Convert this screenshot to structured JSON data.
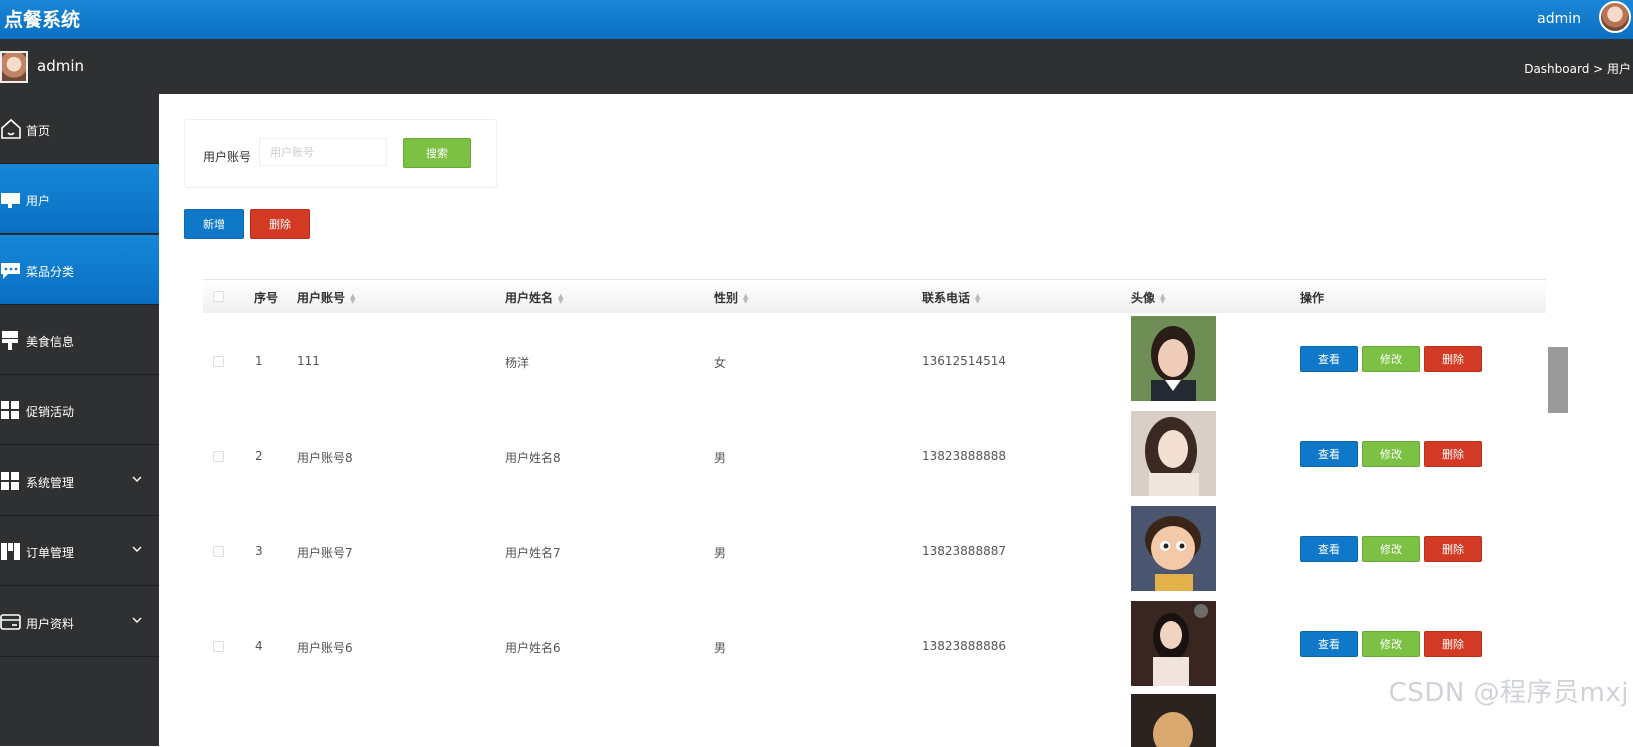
{
  "header": {
    "app_title": "点餐系统",
    "user": "admin"
  },
  "subbar": {
    "name": "admin",
    "breadcrumb": "Dashboard > 用户"
  },
  "sidebar": {
    "items": [
      {
        "label": "首页",
        "icon": "home-icon",
        "expandable": false
      },
      {
        "label": "用户",
        "icon": "monitor-icon",
        "expandable": false,
        "active": true
      },
      {
        "label": "菜品分类",
        "icon": "chat-icon",
        "expandable": false,
        "active": true
      },
      {
        "label": "美食信息",
        "icon": "stamp-icon",
        "expandable": false
      },
      {
        "label": "促销活动",
        "icon": "grid-icon",
        "expandable": false
      },
      {
        "label": "系统管理",
        "icon": "grid-icon",
        "expandable": true
      },
      {
        "label": "订单管理",
        "icon": "box-icon",
        "expandable": true
      },
      {
        "label": "用户资料",
        "icon": "card-icon",
        "expandable": true
      }
    ]
  },
  "search": {
    "label": "用户账号",
    "placeholder": "用户账号",
    "button": "搜索"
  },
  "actions": {
    "add": "新增",
    "delete": "删除"
  },
  "table": {
    "headers": [
      "序号",
      "用户账号",
      "用户姓名",
      "性别",
      "联系电话",
      "头像",
      "操作"
    ],
    "rows": [
      {
        "no": "1",
        "account": "111",
        "name": "杨洋",
        "gender": "女",
        "phone": "13612514514"
      },
      {
        "no": "2",
        "account": "用户账号8",
        "name": "用户姓名8",
        "gender": "男",
        "phone": "13823888888"
      },
      {
        "no": "3",
        "account": "用户账号7",
        "name": "用户姓名7",
        "gender": "男",
        "phone": "13823888887"
      },
      {
        "no": "4",
        "account": "用户账号6",
        "name": "用户姓名6",
        "gender": "男",
        "phone": "13823888886"
      }
    ],
    "row_buttons": {
      "view": "查看",
      "edit": "修改",
      "delete": "删除"
    }
  },
  "watermark": "CSDN @程序员mxj",
  "colors": {
    "header_blue": "#0a6fc2",
    "sidebar_dark": "#2f3032",
    "btn_green": "#7dc144",
    "btn_red": "#d33a24",
    "btn_blue": "#0f78c8"
  }
}
